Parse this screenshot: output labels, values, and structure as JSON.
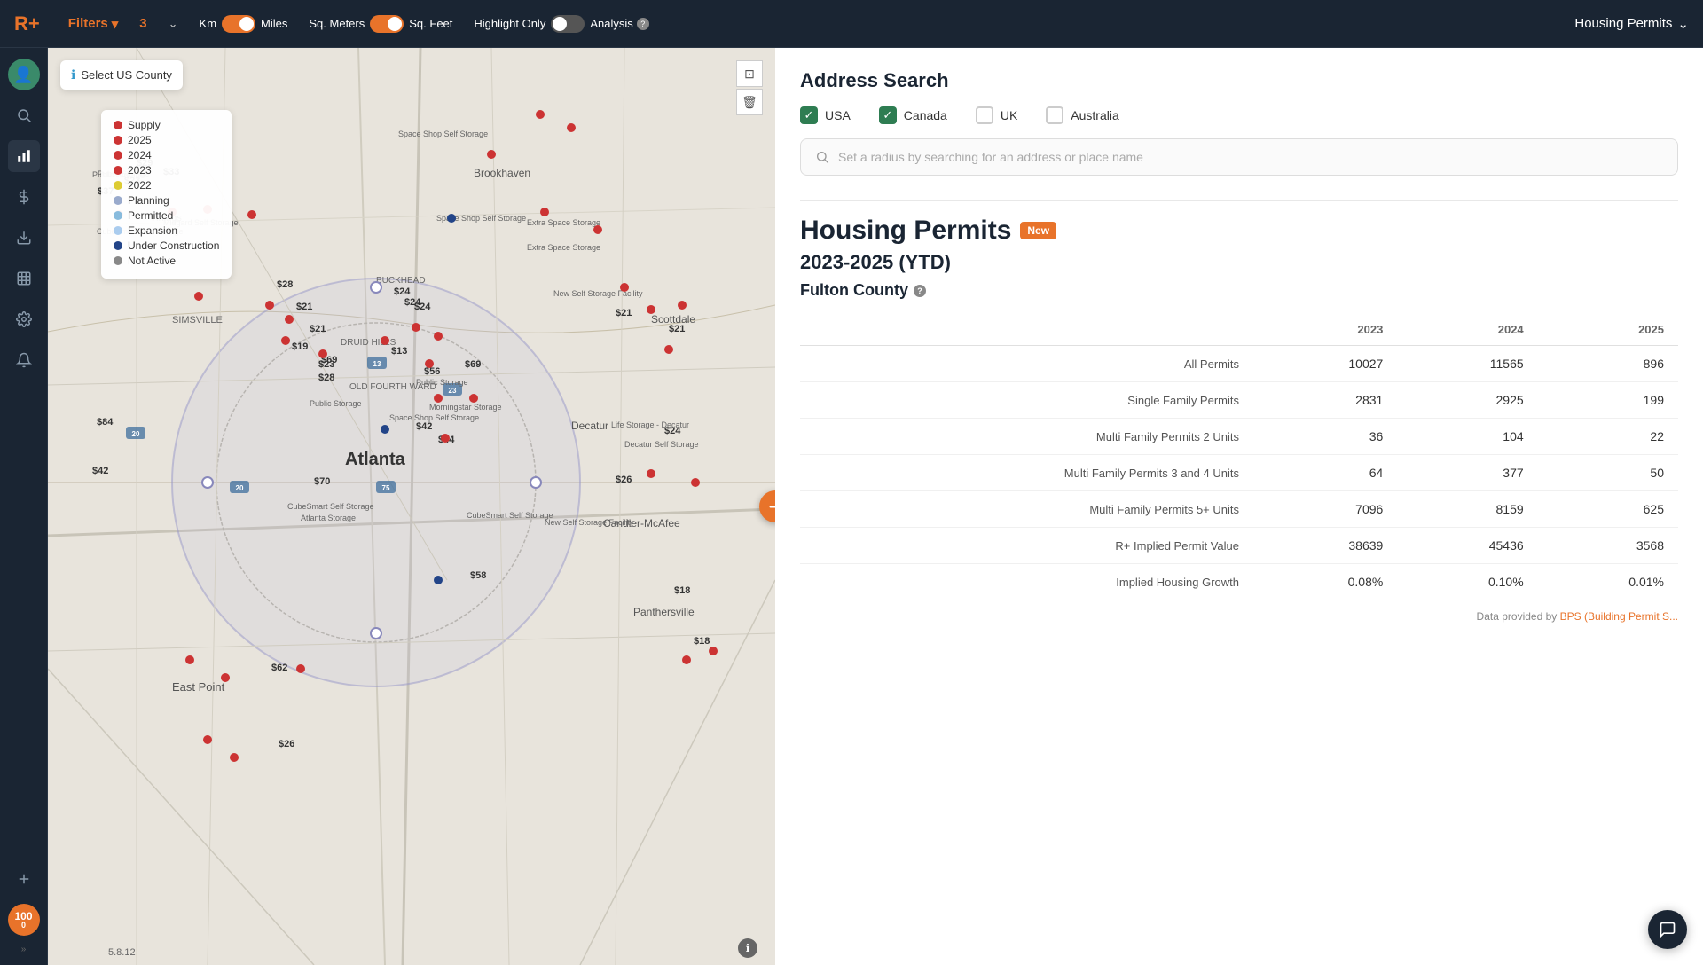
{
  "topnav": {
    "logo": "R+",
    "filters_label": "Filters",
    "filter_count": "3",
    "km_label": "Km",
    "miles_label": "Miles",
    "sq_meters_label": "Sq. Meters",
    "sq_feet_label": "Sq. Feet",
    "highlight_only_label": "Highlight Only",
    "analysis_label": "Analysis",
    "housing_permits_label": "Housing Permits"
  },
  "sidebar": {
    "items": [
      {
        "name": "avatar",
        "icon": "👤"
      },
      {
        "name": "search",
        "icon": "🔍"
      },
      {
        "name": "chart",
        "icon": "📊"
      },
      {
        "name": "dollar",
        "icon": "$"
      },
      {
        "name": "download",
        "icon": "⬇"
      },
      {
        "name": "table",
        "icon": "▦"
      },
      {
        "name": "settings",
        "icon": "⚙"
      },
      {
        "name": "bell",
        "icon": "🔔"
      },
      {
        "name": "plus",
        "icon": "+"
      }
    ],
    "score": "100",
    "score_sub": "0"
  },
  "map": {
    "select_county_label": "Select US County",
    "version": "5.8.12"
  },
  "legend": {
    "items": [
      {
        "label": "Supply",
        "color": "#cc3333"
      },
      {
        "label": "2025",
        "color": "#cc3333"
      },
      {
        "label": "2024",
        "color": "#cc3333"
      },
      {
        "label": "2023",
        "color": "#cc3333"
      },
      {
        "label": "2022",
        "color": "#ddcc33"
      },
      {
        "label": "Planning",
        "color": "#6699cc"
      },
      {
        "label": "Permitted",
        "color": "#88bbdd"
      },
      {
        "label": "Expansion",
        "color": "#aaccee"
      },
      {
        "label": "Under Construction",
        "color": "#224488"
      },
      {
        "label": "Not Active",
        "color": "#888888"
      }
    ]
  },
  "right_panel": {
    "address_search": {
      "title": "Address Search",
      "countries": [
        {
          "label": "USA",
          "checked": true
        },
        {
          "label": "Canada",
          "checked": true
        },
        {
          "label": "UK",
          "checked": false
        },
        {
          "label": "Australia",
          "checked": false
        }
      ],
      "search_placeholder": "Set a radius by searching for an address or place name"
    },
    "housing_permits": {
      "title": "Housing Permits",
      "badge": "New",
      "year_range": "2023-2025 (YTD)",
      "county": "Fulton County",
      "columns": [
        "",
        "2023",
        "2024",
        "2025"
      ],
      "rows": [
        {
          "label": "All Permits",
          "2023": "10027",
          "2024": "11565",
          "2025": "896"
        },
        {
          "label": "Single Family Permits",
          "2023": "2831",
          "2024": "2925",
          "2025": "199"
        },
        {
          "label": "Multi Family Permits 2 Units",
          "2023": "36",
          "2024": "104",
          "2025": "22"
        },
        {
          "label": "Multi Family Permits 3 and 4 Units",
          "2023": "64",
          "2024": "377",
          "2025": "50"
        },
        {
          "label": "Multi Family Permits 5+ Units",
          "2023": "7096",
          "2024": "8159",
          "2025": "625"
        },
        {
          "label": "R+ Implied Permit Value",
          "2023": "38639",
          "2024": "45436",
          "2025": "3568"
        },
        {
          "label": "Implied Housing Growth",
          "2023": "0.08%",
          "2024": "0.10%",
          "2025": "0.01%"
        }
      ],
      "data_source_text": "Data provided by ",
      "data_source_link": "BPS (Building Permit S..."
    }
  }
}
